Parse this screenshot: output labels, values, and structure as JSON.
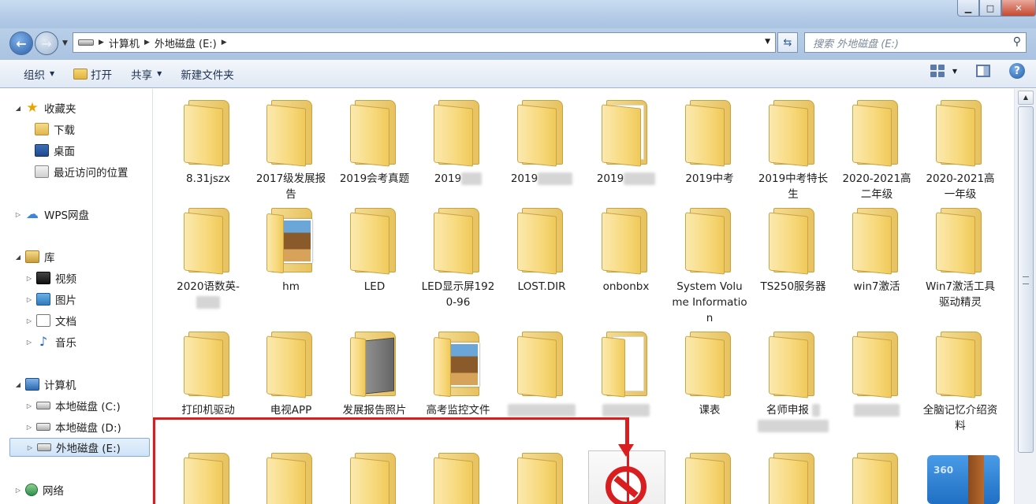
{
  "window": {
    "controls": {
      "minimize": "▁",
      "maximize": "□",
      "close": "✕"
    }
  },
  "address": {
    "path": [
      "计算机",
      "外地磁盘 (E:)"
    ],
    "search_placeholder": "搜索 外地磁盘 (E:)"
  },
  "toolbar": {
    "organize": "组织",
    "open": "打开",
    "share": "共享",
    "new_folder": "新建文件夹",
    "help": "?"
  },
  "nav": {
    "favorites": "收藏夹",
    "downloads": "下载",
    "desktop": "桌面",
    "recent": "最近访问的位置",
    "wps": "WPS网盘",
    "libraries": "库",
    "videos": "视频",
    "pictures": "图片",
    "documents": "文档",
    "music": "音乐",
    "computer": "计算机",
    "drive_c": "本地磁盘 (C:)",
    "drive_d": "本地磁盘 (D:)",
    "drive_e": "外地磁盘 (E:)",
    "network": "网络"
  },
  "files": {
    "r1": [
      "8.31jszx",
      "2017级发展报告",
      "2019会考真题",
      "2019",
      "2019",
      "2019",
      "2019中考",
      "2019中考特长生",
      "2020-2021高二年级",
      "2020-2021高一年级"
    ],
    "r2": [
      "2020语数英-",
      "hm",
      "LED",
      "LED显示屏1920-96",
      "LOST.DIR",
      "onbonbx",
      "System Volume Information",
      "TS250服务器",
      "win7激活",
      "Win7激活工具驱动精灵"
    ],
    "r3": [
      "打印机驱动",
      "电视APP",
      "发展报告照片",
      "高考监控文件",
      "",
      "",
      "课表",
      "名师申报",
      "",
      "全脑记忆介绍资料"
    ],
    "r4_zip": "360"
  }
}
